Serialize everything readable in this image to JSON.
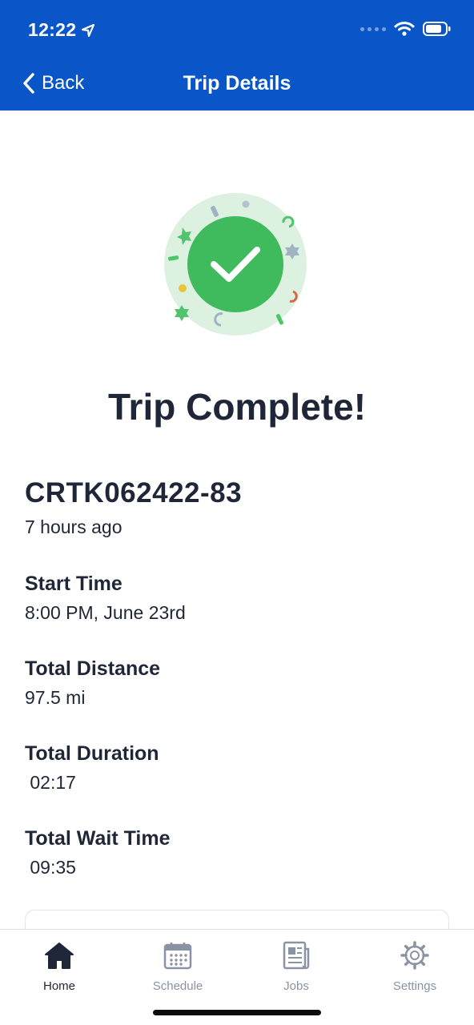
{
  "status_bar": {
    "time": "12:22"
  },
  "nav": {
    "back_label": "Back",
    "title": "Trip Details"
  },
  "headline": "Trip Complete!",
  "trip": {
    "id": "CRTK062422-83",
    "ago": "7 hours ago"
  },
  "fields": [
    {
      "label": "Start Time",
      "value": "8:00 PM, June 23rd"
    },
    {
      "label": "Total Distance",
      "value": "97.5 mi"
    },
    {
      "label": "Total Duration",
      "value": " 02:17"
    },
    {
      "label": "Total Wait Time",
      "value": " 09:35"
    }
  ],
  "tabs": [
    {
      "label": "Home",
      "icon": "home-icon",
      "active": true
    },
    {
      "label": "Schedule",
      "icon": "calendar-icon",
      "active": false
    },
    {
      "label": "Jobs",
      "icon": "newspaper-icon",
      "active": false
    },
    {
      "label": "Settings",
      "icon": "gear-icon",
      "active": false
    }
  ],
  "colors": {
    "header": "#0a55c8",
    "success": "#3fbb5e",
    "text": "#1f2637",
    "inactive": "#8a93a3"
  }
}
